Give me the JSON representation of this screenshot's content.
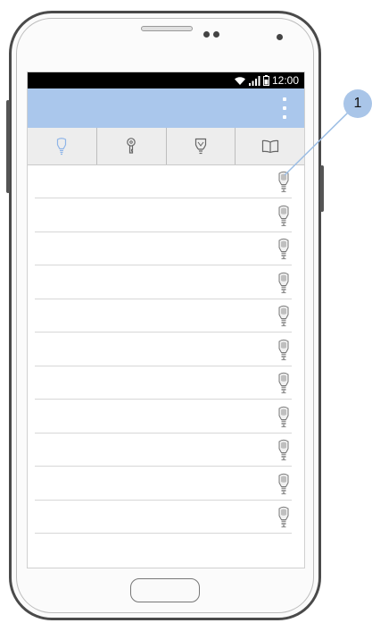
{
  "status_bar": {
    "time": "12:00",
    "icons": [
      "wifi-icon",
      "signal-icon",
      "battery-icon"
    ]
  },
  "app_bar": {
    "menu_icon": "overflow-menu-icon"
  },
  "tabs": [
    {
      "icon": "lightbulb-icon",
      "selected": true
    },
    {
      "icon": "key-icon",
      "selected": false
    },
    {
      "icon": "bulb-socket-icon",
      "selected": false
    },
    {
      "icon": "book-icon",
      "selected": false
    }
  ],
  "list": {
    "row_count": 11,
    "row_icon": "lightbulb-icon"
  },
  "callout": {
    "number": "1"
  },
  "colors": {
    "app_bar": "#aac7ec",
    "tab_bar": "#ededed",
    "selected_tab_icon": "#8fb5e8",
    "callout_badge": "#a9c5e8"
  }
}
